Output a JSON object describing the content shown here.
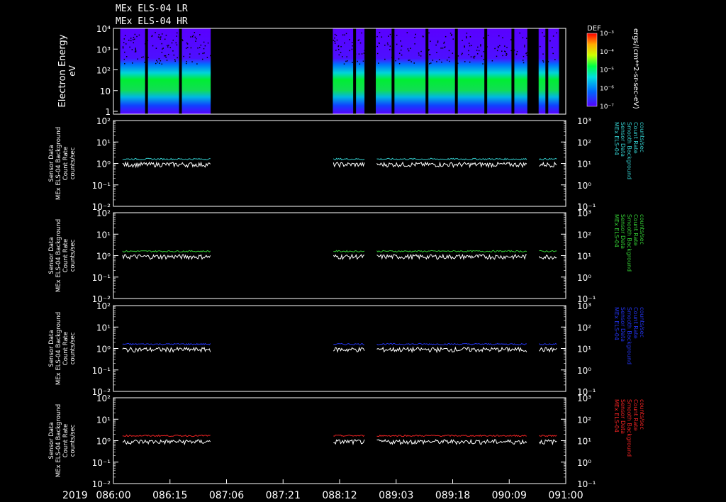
{
  "header": {
    "line1": "MEx ELS-04 LR",
    "line2": "MEx ELS-04 HR"
  },
  "time_axis": {
    "year": "2019",
    "ticks": [
      "086:00",
      "086:15",
      "087:06",
      "087:21",
      "088:12",
      "089:03",
      "089:18",
      "090:09",
      "091:00"
    ]
  },
  "data_gaps": [
    [
      0.215,
      0.485
    ],
    [
      0.555,
      0.58
    ],
    [
      0.915,
      0.94
    ]
  ],
  "spectrogram": {
    "ylabel_line1": "Electron Energy",
    "ylabel_line2": "eV",
    "colorbar_title": "DEF",
    "colorbar_label": "ergs/(cm**2-sr-sec-eV)",
    "colorbar_ticks": [
      "10⁻³",
      "10⁻⁴",
      "10⁻⁵",
      "10⁻⁶",
      "10⁻⁷"
    ],
    "colorbar_range": [
      -7,
      -3
    ],
    "yticks": [
      "10⁴",
      "10³",
      "10²",
      "10",
      "1"
    ],
    "yrange": [
      1,
      10000
    ],
    "log_scale": true
  },
  "chart_data": [
    {
      "type": "line",
      "panel": 1,
      "left_axis_label": [
        "Sensor Data",
        "MEx ELS-04 Background",
        "Count Rate",
        "counts/sec"
      ],
      "right_axis_label": [
        "MEx ELS-04",
        "Sensor Data",
        "Smooth Background",
        "Count Rate",
        "counts/sec"
      ],
      "left_ticks": [
        "10²",
        "10¹",
        "10⁰",
        "10⁻¹",
        "10⁻²"
      ],
      "right_ticks": [
        "10³",
        "10²",
        "10¹",
        "10⁰",
        "10⁻¹"
      ],
      "ylim_left": [
        0.01,
        100
      ],
      "ylim_right": [
        0.1,
        1000
      ],
      "log_scale": true,
      "series": [
        {
          "color": "#ffffff",
          "level": 0.9
        },
        {
          "color": "#33cccc",
          "level": 1.6
        }
      ]
    },
    {
      "type": "line",
      "panel": 2,
      "left_axis_label": [
        "Sensor Data",
        "MEx ELS-04 Background",
        "Count Rate",
        "counts/sec"
      ],
      "right_axis_label": [
        "MEx ELS-04",
        "Sensor Data",
        "Smooth Background",
        "Count Rate",
        "counts/sec"
      ],
      "left_ticks": [
        "10²",
        "10¹",
        "10⁰",
        "10⁻¹",
        "10⁻²"
      ],
      "right_ticks": [
        "10³",
        "10²",
        "10¹",
        "10⁰",
        "10⁻¹"
      ],
      "ylim_left": [
        0.01,
        100
      ],
      "ylim_right": [
        0.1,
        1000
      ],
      "log_scale": true,
      "series": [
        {
          "color": "#ffffff",
          "level": 0.9
        },
        {
          "color": "#33cc33",
          "level": 1.6
        }
      ]
    },
    {
      "type": "line",
      "panel": 3,
      "left_axis_label": [
        "Sensor Data",
        "MEx ELS-04 Background",
        "Count Rate",
        "counts/sec"
      ],
      "right_axis_label": [
        "MEx ELS-04",
        "Sensor Data",
        "Smooth Background",
        "Count Rate",
        "counts/sec"
      ],
      "left_ticks": [
        "10²",
        "10¹",
        "10⁰",
        "10⁻¹",
        "10⁻²"
      ],
      "right_ticks": [
        "10³",
        "10²",
        "10¹",
        "10⁰",
        "10⁻¹"
      ],
      "ylim_left": [
        0.01,
        100
      ],
      "ylim_right": [
        0.1,
        1000
      ],
      "log_scale": true,
      "series": [
        {
          "color": "#ffffff",
          "level": 0.9
        },
        {
          "color": "#2233ee",
          "level": 1.6
        }
      ]
    },
    {
      "type": "line",
      "panel": 4,
      "left_axis_label": [
        "Sensor Data",
        "MEx ELS-04 Background",
        "Count Rate",
        "counts/sec"
      ],
      "right_axis_label": [
        "MEx ELS-04",
        "Sensor Data",
        "Smooth Background",
        "Count Rate",
        "counts/sec"
      ],
      "left_ticks": [
        "10²",
        "10¹",
        "10⁰",
        "10⁻¹",
        "10⁻²"
      ],
      "right_ticks": [
        "10³",
        "10²",
        "10¹",
        "10⁰",
        "10⁻¹"
      ],
      "ylim_left": [
        0.01,
        100
      ],
      "ylim_right": [
        0.1,
        1000
      ],
      "log_scale": true,
      "series": [
        {
          "color": "#ffffff",
          "level": 0.9
        },
        {
          "color": "#ee2222",
          "level": 1.7
        }
      ]
    }
  ]
}
